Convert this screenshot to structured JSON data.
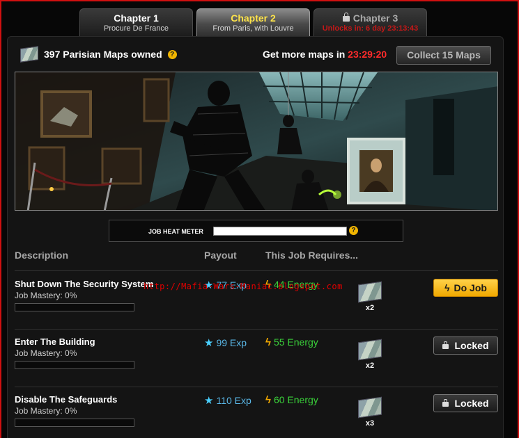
{
  "tabs": [
    {
      "title": "Chapter 1",
      "subtitle": "Procure De France",
      "state": "normal"
    },
    {
      "title": "Chapter 2",
      "subtitle": "From Paris, with Louvre",
      "state": "active"
    },
    {
      "title": "Chapter 3",
      "subtitle": "Unlocks in: 6 day 23:13:43",
      "state": "locked"
    }
  ],
  "maps": {
    "icon": "map-icon",
    "owned_label": "397 Parisian Maps owned",
    "get_more_label": "Get more maps in",
    "timer": "23:29:20",
    "collect_label": "Collect 15 Maps"
  },
  "heat_meter": {
    "label": "JOB HEAT METER",
    "level": 0
  },
  "headers": {
    "description": "Description",
    "payout": "Payout",
    "requires": "This Job Requires..."
  },
  "jobs": [
    {
      "title": "Shut Down The Security System",
      "mastery": "Job Mastery: 0%",
      "mastery_pct": 0,
      "exp": "77 Exp",
      "energy": "44 Energy",
      "req_qty": "x2",
      "action": "Do Job",
      "action_state": "available"
    },
    {
      "title": "Enter The Building",
      "mastery": "Job Mastery: 0%",
      "mastery_pct": 0,
      "exp": "99 Exp",
      "energy": "55 Energy",
      "req_qty": "x2",
      "action": "Locked",
      "action_state": "locked"
    },
    {
      "title": "Disable The Safeguards",
      "mastery": "Job Mastery: 0%",
      "mastery_pct": 0,
      "exp": "110 Exp",
      "energy": "60 Energy",
      "req_qty": "x3",
      "action": "Locked",
      "action_state": "locked"
    }
  ],
  "watermark": "http://Mafia-Wars-Maniac.blogspot.com",
  "colors": {
    "accent_yellow": "#ffe44a",
    "timer_red": "#ff2b2b",
    "exp_blue": "#5ab8e8",
    "energy_green": "#3ad23a",
    "button_gold": "#f0a800"
  }
}
